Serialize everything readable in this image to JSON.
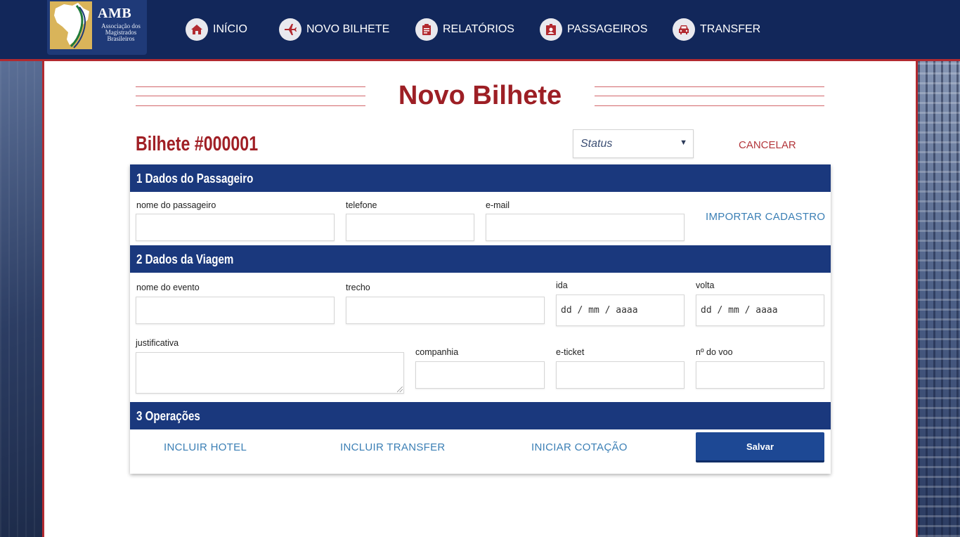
{
  "header": {
    "logo": {
      "title": "AMB",
      "subtitle": [
        "Associação dos",
        "Magistrados",
        "Brasileiros"
      ]
    },
    "nav": [
      {
        "label": "INÍCIO",
        "icon": "home-icon"
      },
      {
        "label": "NOVO BILHETE",
        "icon": "airplane-icon"
      },
      {
        "label": "RELATÓRIOS",
        "icon": "clipboard-icon"
      },
      {
        "label": "PASSAGEIROS",
        "icon": "id-badge-icon"
      },
      {
        "label": "TRANSFER",
        "icon": "car-icon"
      }
    ]
  },
  "page": {
    "title": "Novo Bilhete",
    "ticket_number": "Bilhete #000001",
    "status_placeholder": "Status",
    "cancel_label": "CANCELAR"
  },
  "sections": {
    "passenger": {
      "heading": "1 Dados do Passageiro",
      "name_label": "nome do passageiro",
      "phone_label": "telefone",
      "email_label": "e-mail",
      "import_label": "IMPORTAR CADASTRO"
    },
    "trip": {
      "heading": "2 Dados da Viagem",
      "event_label": "nome do evento",
      "route_label": "trecho",
      "departure_label": "ida",
      "departure_value": "dd / mm / aaaa",
      "return_label": "volta",
      "return_value": "dd / mm / aaaa",
      "justification_label": "justificativa",
      "airline_label": "companhia",
      "eticket_label": "e-ticket",
      "flight_label": "nº do voo"
    },
    "operations": {
      "heading": "3 Operações",
      "include_hotel": "INCLUIR HOTEL",
      "include_transfer": "INCLUIR TRANSFER",
      "start_quote": "INICIAR COTAÇÃO",
      "save_label": "Salvar"
    }
  },
  "colors": {
    "header_bg": "#12275a",
    "accent_red": "#9d1f25",
    "section_bar": "#1a387d",
    "link_blue": "#3b7fb5",
    "button_blue": "#1d4894"
  }
}
